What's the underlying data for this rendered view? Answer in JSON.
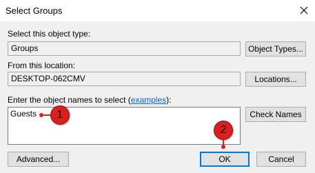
{
  "window": {
    "title": "Select Groups",
    "close_icon": "close-icon"
  },
  "object_type": {
    "label": "Select this object type:",
    "value": "Groups",
    "button_label": "Object Types..."
  },
  "location": {
    "label": "From this location:",
    "value": "DESKTOP-062CMV",
    "button_label": "Locations..."
  },
  "object_names": {
    "label_prefix": "Enter the object names to select (",
    "link_text": "examples",
    "label_suffix": "):",
    "value": "Guests",
    "button_label": "Check Names"
  },
  "footer": {
    "advanced_label": "Advanced...",
    "ok_label": "OK",
    "cancel_label": "Cancel"
  },
  "annotations": [
    {
      "number": "1"
    },
    {
      "number": "2"
    }
  ],
  "colors": {
    "marker": "#dd1f1f",
    "link": "#0066cc",
    "default_button_border": "#0078d7"
  }
}
